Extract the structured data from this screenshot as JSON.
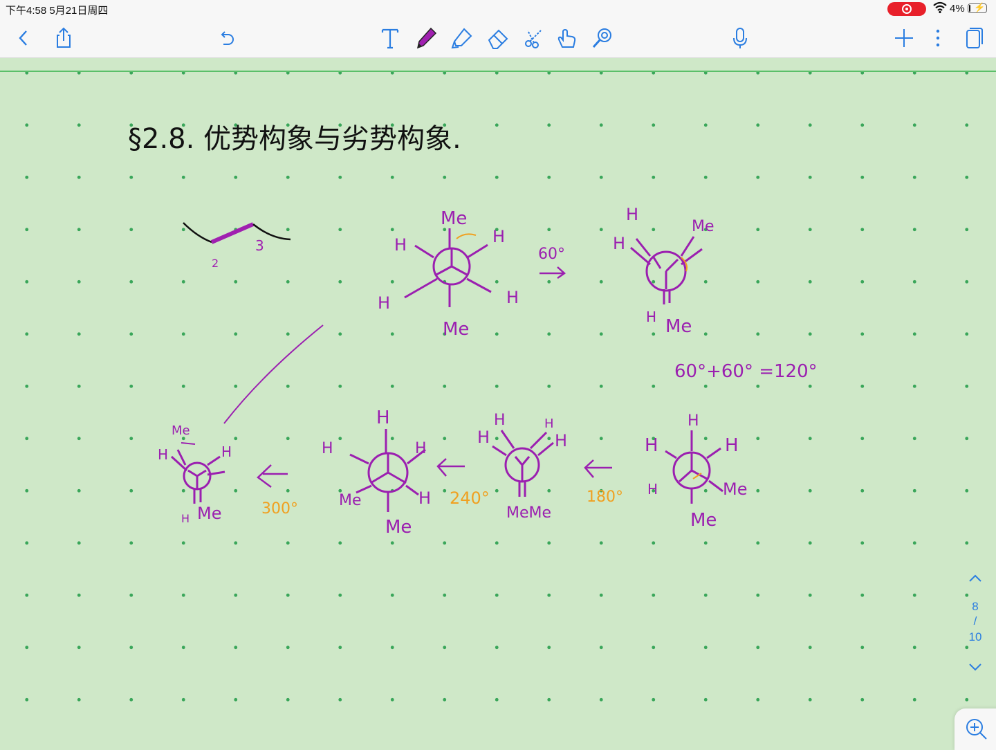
{
  "status_bar": {
    "time": "下午4:58   5月21日周四",
    "battery_percent": "4%",
    "battery_level": 0.04,
    "wifi_icon": "wifi-icon",
    "recording_icon": "screen-recording-icon"
  },
  "toolbar": {
    "left": [
      {
        "name": "back-button",
        "icon": "chevron-left-icon"
      },
      {
        "name": "share-button",
        "icon": "share-icon"
      },
      {
        "name": "undo-button",
        "icon": "undo-icon"
      }
    ],
    "tools": [
      {
        "name": "text-tool-button",
        "icon": "text-tool-icon"
      },
      {
        "name": "pen-tool-button",
        "icon": "pen-icon",
        "selected": true
      },
      {
        "name": "highlighter-tool-button",
        "icon": "highlighter-icon"
      },
      {
        "name": "eraser-tool-button",
        "icon": "eraser-icon"
      },
      {
        "name": "scissors-tool-button",
        "icon": "scissors-icon"
      },
      {
        "name": "hand-tool-button",
        "icon": "hand-icon"
      },
      {
        "name": "laser-tool-button",
        "icon": "laser-pointer-icon"
      }
    ],
    "mic": {
      "name": "microphone-button",
      "icon": "microphone-icon"
    },
    "right": [
      {
        "name": "add-page-button",
        "icon": "plus-icon"
      },
      {
        "name": "more-button",
        "icon": "more-vertical-icon"
      },
      {
        "name": "pages-button",
        "icon": "pages-icon"
      }
    ],
    "accent_color": "#2a7de1",
    "pen_color": "#a020b0"
  },
  "note": {
    "heading": "§2.8. 优势构象与劣势构象.",
    "ink_color": "#9b1fb0",
    "angle_color": "#f0a020",
    "bond_labels": [
      "2",
      "3"
    ],
    "newman_top_row": [
      {
        "front": [
          "Me",
          "H",
          "H"
        ],
        "back": [
          "H",
          "H",
          "Me"
        ]
      },
      {
        "front": [
          "H",
          "Me",
          "H"
        ],
        "back": [
          "H",
          "Me"
        ]
      }
    ],
    "rotation_labels": [
      "60°",
      "180°",
      "240°",
      "300°"
    ],
    "sum_equation": "60°+60° =120°",
    "labels_row2": {
      "a": [
        "Me",
        "H",
        "H",
        "H",
        "Me"
      ],
      "b": [
        "H",
        "H",
        "H",
        "Me",
        "H",
        "Me"
      ],
      "c": [
        "H",
        "H",
        "H",
        "H",
        "MeMe"
      ],
      "d": [
        "H",
        "H",
        "H",
        "H",
        "Me",
        "Me"
      ]
    },
    "page_bg": "#cfe8c8",
    "dot_color": "#3aa65a"
  },
  "pager": {
    "current": "8",
    "slash": "/",
    "total": "10",
    "up_icon": "chevron-up-icon",
    "down_icon": "chevron-down-icon"
  },
  "zoom": {
    "icon": "zoom-in-icon"
  }
}
